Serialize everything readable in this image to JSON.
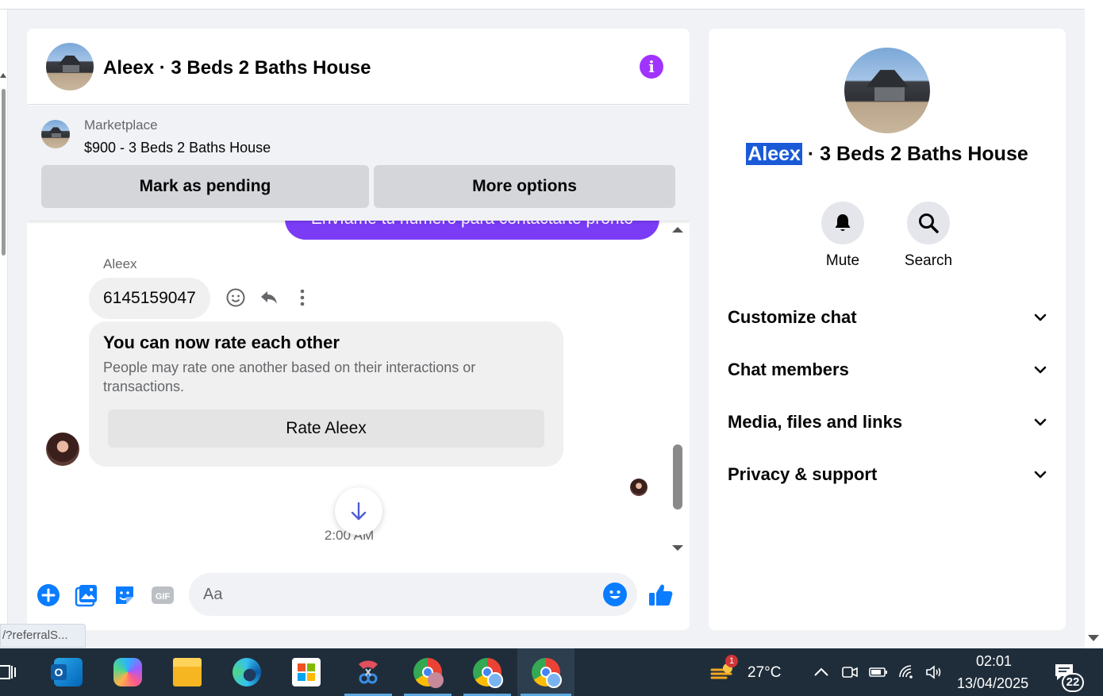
{
  "chat": {
    "title": "Aleex · 3 Beds 2 Baths House",
    "listing": {
      "source": "Marketplace",
      "title": "$900 - 3 Beds 2 Baths House",
      "mark_pending": "Mark as pending",
      "more_options": "More options"
    },
    "messages": {
      "sent_text": "Envíame tu número para contactarte pronto",
      "sender_name": "Aleex",
      "received_text": "6145159047",
      "rate_title": "You can now rate each other",
      "rate_desc": "People may rate one another based on their interactions or transactions.",
      "rate_button": "Rate Aleex",
      "timestamp": "2:00 AM"
    },
    "composer": {
      "placeholder": "Aa"
    }
  },
  "url_tooltip": "/?referralS...",
  "info_panel": {
    "name_highlight": "Aleex",
    "name_rest": " · 3 Beds 2 Baths House",
    "actions": {
      "mute": "Mute",
      "search": "Search"
    },
    "sections": [
      "Customize chat",
      "Chat members",
      "Media, files and links",
      "Privacy & support"
    ]
  },
  "taskbar": {
    "weather_temp": "27°C",
    "weather_badge": "1",
    "time": "02:01",
    "date": "13/04/2025",
    "notifications_count": "22"
  },
  "colors": {
    "messenger_purple": "#7b3cf6",
    "info_purple": "#a033ff",
    "accent_blue": "#0a7cff",
    "highlight_blue": "#1a5ad7",
    "taskbar": "#1f2d3a"
  }
}
